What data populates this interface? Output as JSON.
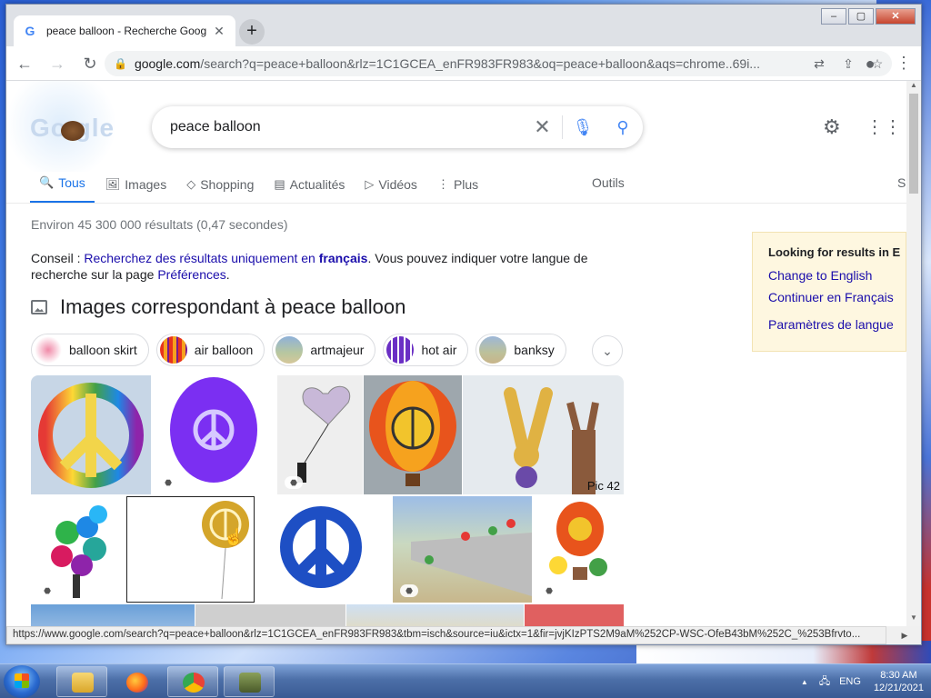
{
  "browser": {
    "tab_title": "peace balloon - Recherche Goog",
    "tab_close": "✕",
    "new_tab": "+",
    "window_controls": {
      "minimize": "‒",
      "maximize": "▢",
      "close": "✕"
    },
    "url_domain": "google.com",
    "url_rest": "/search?q=peace+balloon&rlz=1C1GCEA_enFR983FR983&oq=peace+balloon&aqs=chrome..69i...",
    "status_url": "https://www.google.com/search?q=peace+balloon&rlz=1C1GCEA_enFR983FR983&tbm=isch&source=iu&ictx=1&fir=jvjKIzPTS2M9aM%252CP-WSC-OfeB43bM%252C_%253Bfrvto..."
  },
  "search": {
    "query": "peace balloon",
    "logo_text": "Go   gle"
  },
  "nav": {
    "tabs": [
      {
        "label": "Tous",
        "icon": "🔍",
        "active": true
      },
      {
        "label": "Images",
        "icon": "🖼"
      },
      {
        "label": "Shopping",
        "icon": "◇"
      },
      {
        "label": "Actualités",
        "icon": "▤"
      },
      {
        "label": "Vidéos",
        "icon": "▷"
      },
      {
        "label": "Plus",
        "icon": "⋮"
      }
    ],
    "tools": "Outils",
    "edge_letter": "S"
  },
  "results": {
    "stats": "Environ 45 300 000 résultats (0,47 secondes)",
    "tip_prefix": "Conseil : ",
    "tip_link": "Recherchez des résultats uniquement en ",
    "tip_lang": "français",
    "tip_middle": ". Vous pouvez indiquer votre langue de recherche sur la page ",
    "tip_prefs": "Préférences",
    "tip_end": "."
  },
  "images": {
    "heading": "Images correspondant à peace balloon",
    "chips": [
      "balloon skirt",
      "air balloon",
      "artmajeur",
      "hot air",
      "banksy"
    ],
    "pic_label": "Pic 42"
  },
  "language_panel": {
    "heading": "Looking for results in E",
    "link1": "Change to English",
    "link2": "Continuer en Français",
    "link3": "Paramètres de langue"
  },
  "taskbar": {
    "lang": "ENG",
    "time": "8:30 AM",
    "date": "12/21/2021"
  },
  "colors": {
    "accent": "#1a73e8",
    "link": "#1a0dab",
    "panel_bg": "#fef7e0"
  }
}
